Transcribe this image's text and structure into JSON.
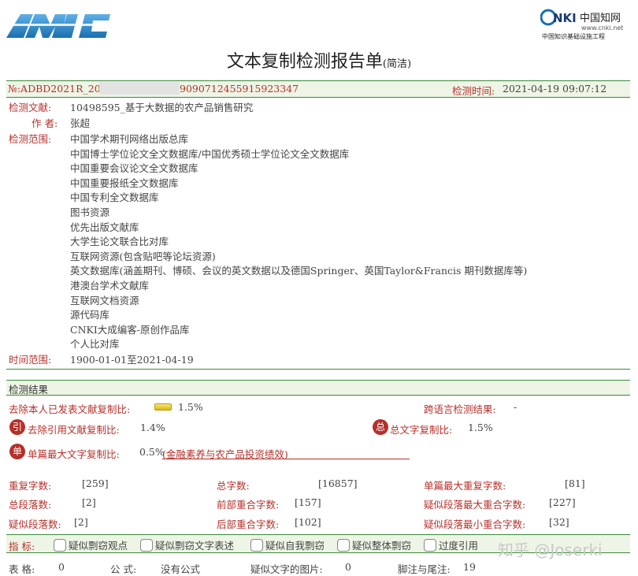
{
  "header": {
    "logo_left_text": "AMLC",
    "logo_right_brand": "CNKI中国知网",
    "logo_right_url": "www.cnki.net",
    "logo_right_subtitle": "中国知识基础设施工程"
  },
  "title": {
    "main": "文本复制检测报告单",
    "suffix": "(简洁)"
  },
  "report": {
    "number_prefix": "№:ADBD2021R_20",
    "number_suffix": "9090712455915923347",
    "detect_time_label": "检测时间:",
    "detect_time_value": "2021-04-19 09:07:12",
    "doc_label": "检测文献:",
    "doc_value": "10498595_基于大数据的农产品销售研究",
    "author_label": "作 者:",
    "author_value": "张超",
    "scope_label": "检测范围:",
    "scope_items": [
      "中国学术期刊网络出版总库",
      "中国博士学位论文全文数据库/中国优秀硕士学位论文全文数据库",
      "中国重要会议论文全文数据库",
      "中国重要报纸全文数据库",
      "中国专利全文数据库",
      "图书资源",
      "优先出版文献库",
      "大学生论文联合比对库",
      "互联网资源(包含贴吧等论坛资源)",
      "英文数据库(涵盖期刊、博硕、会议的英文数据以及德国Springer、英国Taylor&Francis 期刊数据库等)",
      "港澳台学术文献库",
      "互联网文档资源",
      "源代码库",
      "CNKI大成编客-原创作品库",
      "个人比对库"
    ],
    "time_range_label": "时间范围:",
    "time_range_value": "1900-01-01至2021-04-19"
  },
  "results": {
    "section_title": "检测结果",
    "self_removed_label": "去除本人已发表文献复制比:",
    "self_removed_value": "1.5%",
    "cross_lang_label": "跨语言检测结果:",
    "cross_lang_value": "-",
    "cite_icon": "引",
    "cite_removed_label": "去除引用文献复制比:",
    "cite_removed_value": "1.4%",
    "total_icon": "总",
    "total_label": "总文字复制比:",
    "total_value": "1.5%",
    "single_icon": "单",
    "single_label": "单篇最大文字复制比:",
    "single_value": "0.5%",
    "single_source": "(金融素养与农产品投资绩效)"
  },
  "stats": {
    "dup_chars_label": "重复字数:",
    "dup_chars_value": "[259]",
    "total_chars_label": "总字数:",
    "total_chars_value": "[16857]",
    "single_max_dup_label": "单篇最大重复字数:",
    "single_max_dup_value": "[81]",
    "total_para_label": "总段落数:",
    "total_para_value": "[2]",
    "front_overlap_label": "前部重合字数:",
    "front_overlap_value": "[157]",
    "susp_para_max_label": "疑似段落最大重合字数:",
    "susp_para_max_value": "[227]",
    "susp_para_label": "疑似段落数:",
    "susp_para_value": "[2]",
    "back_overlap_label": "后部重合字数:",
    "back_overlap_value": "[102]",
    "susp_para_min_label": "疑似段落最小重合字数:",
    "susp_para_min_value": "[32]"
  },
  "indicators": {
    "label": "指 标:",
    "items": [
      "疑似剽窃观点",
      "疑似剽窃文字表述",
      "疑似自我剽窃",
      "疑似整体剽窃",
      "过度引用"
    ]
  },
  "footer": {
    "table_label": "表 格:",
    "table_value": "0",
    "formula_label": "公 式:",
    "formula_value": "没有公式",
    "images_label": "疑似文字的图片:",
    "images_value": "0",
    "notes_label": "脚注与尾注:",
    "notes_value": "19"
  },
  "watermark": "知乎 @Joserki",
  "colors": {
    "accent_red": "#b5302a",
    "accent_green": "#3a8a3a",
    "bar_bg": "#eef5e6",
    "logo_blue": "#1a6fb0"
  }
}
